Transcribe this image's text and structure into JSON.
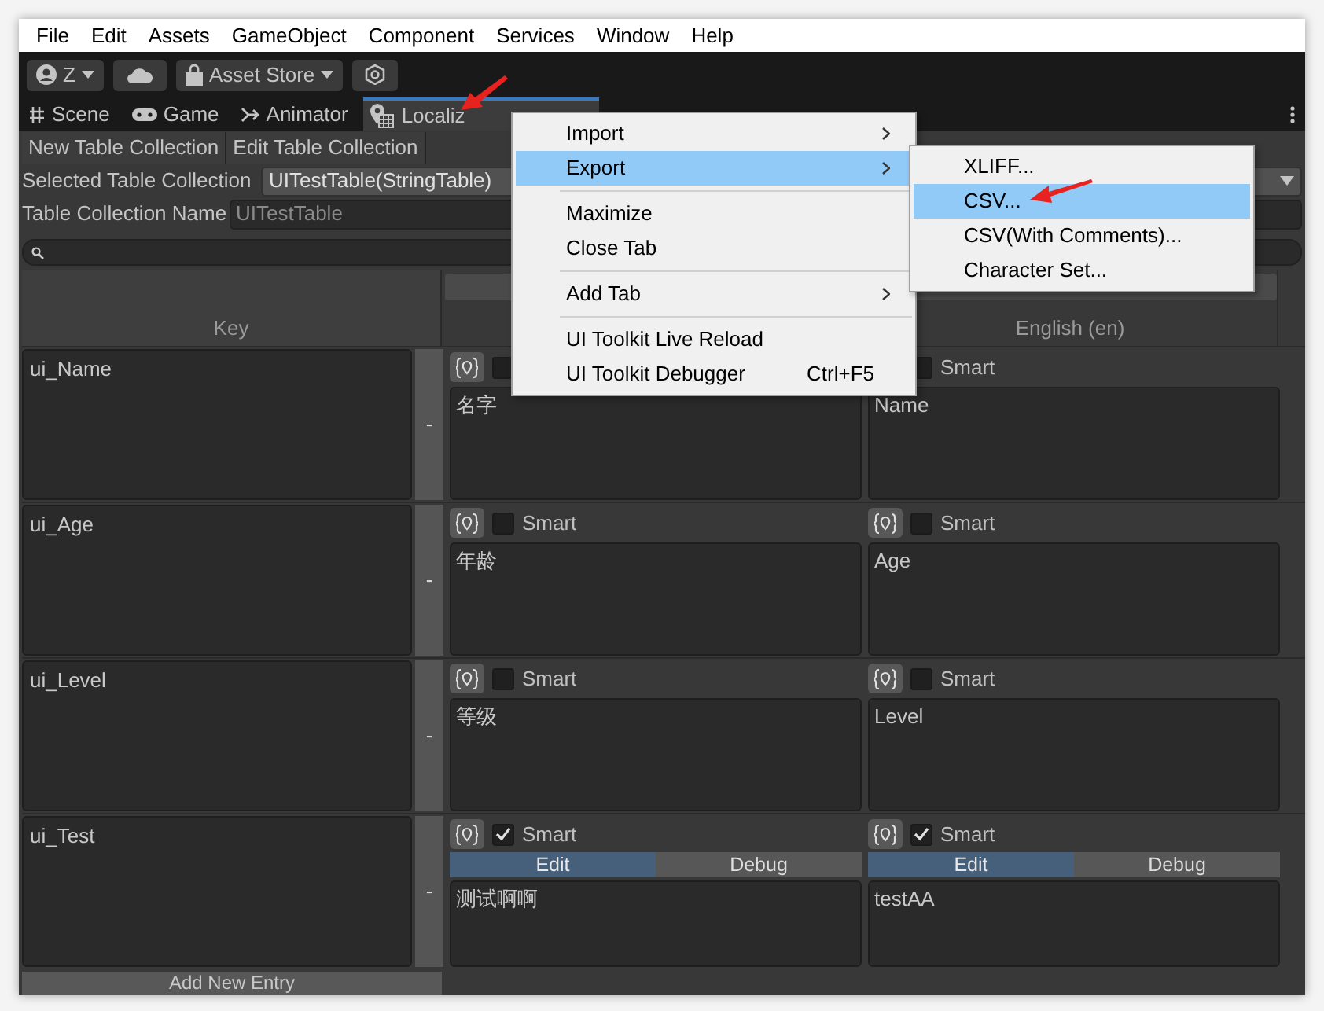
{
  "menu_bar": [
    "File",
    "Edit",
    "Assets",
    "GameObject",
    "Component",
    "Services",
    "Window",
    "Help"
  ],
  "toolbar": {
    "account": "Z",
    "store": "Asset Store"
  },
  "tabs": [
    {
      "label": "Scene",
      "selected": false
    },
    {
      "label": "Game",
      "selected": false
    },
    {
      "label": "Animator",
      "selected": false
    },
    {
      "label": "Localiz",
      "selected": true
    }
  ],
  "action_buttons": [
    "New Table Collection",
    "Edit Table Collection"
  ],
  "selected_table_collection": {
    "label": "Selected Table Collection",
    "value": "UITestTable(StringTable)"
  },
  "table_collection_name": {
    "label": "Table Collection Name",
    "value": "UITestTable"
  },
  "column_headers": {
    "key": "Key",
    "locale_2": "English (en)"
  },
  "rows": [
    {
      "key": "ui_Name",
      "remove": "-",
      "cells": [
        {
          "smart": false,
          "value": "名字"
        },
        {
          "smart": false,
          "smart_label": "Smart",
          "value": "Name"
        }
      ]
    },
    {
      "key": "ui_Age",
      "remove": "-",
      "cells": [
        {
          "smart": false,
          "smart_label": "Smart",
          "value": "年龄"
        },
        {
          "smart": false,
          "smart_label": "Smart",
          "value": "Age"
        }
      ]
    },
    {
      "key": "ui_Level",
      "remove": "-",
      "cells": [
        {
          "smart": false,
          "smart_label": "Smart",
          "value": "等级"
        },
        {
          "smart": false,
          "smart_label": "Smart",
          "value": "Level"
        }
      ]
    },
    {
      "key": "ui_Test",
      "remove": "-",
      "cells": [
        {
          "smart": true,
          "smart_label": "Smart",
          "value": "测试啊啊",
          "modes": [
            {
              "label": "Edit",
              "selected": true
            },
            {
              "label": "Debug",
              "selected": false
            }
          ]
        },
        {
          "smart": true,
          "smart_label": "Smart",
          "value": "testAA",
          "modes": [
            {
              "label": "Edit",
              "selected": true
            },
            {
              "label": "Debug",
              "selected": false
            }
          ]
        }
      ]
    }
  ],
  "add_entry": "Add New Entry",
  "context_menu": {
    "items": [
      {
        "kind": "item",
        "label": "Import",
        "has_submenu": true,
        "selected": false
      },
      {
        "kind": "item",
        "label": "Export",
        "has_submenu": true,
        "selected": true
      },
      {
        "kind": "separator"
      },
      {
        "kind": "item",
        "label": "Maximize",
        "has_submenu": false,
        "selected": false
      },
      {
        "kind": "item",
        "label": "Close Tab",
        "has_submenu": false,
        "selected": false
      },
      {
        "kind": "separator"
      },
      {
        "kind": "item",
        "label": "Add Tab",
        "has_submenu": true,
        "selected": false
      },
      {
        "kind": "separator"
      },
      {
        "kind": "item",
        "label": "UI Toolkit Live Reload",
        "has_submenu": false,
        "selected": false
      },
      {
        "kind": "item",
        "label": "UI Toolkit Debugger",
        "shortcut": "Ctrl+F5",
        "has_submenu": false,
        "selected": false
      }
    ]
  },
  "submenu": {
    "items": [
      {
        "label": "XLIFF...",
        "selected": false
      },
      {
        "label": "CSV...",
        "selected": true
      },
      {
        "label": "CSV(With Comments)...",
        "selected": false
      },
      {
        "label": "Character Set...",
        "selected": false
      }
    ]
  }
}
